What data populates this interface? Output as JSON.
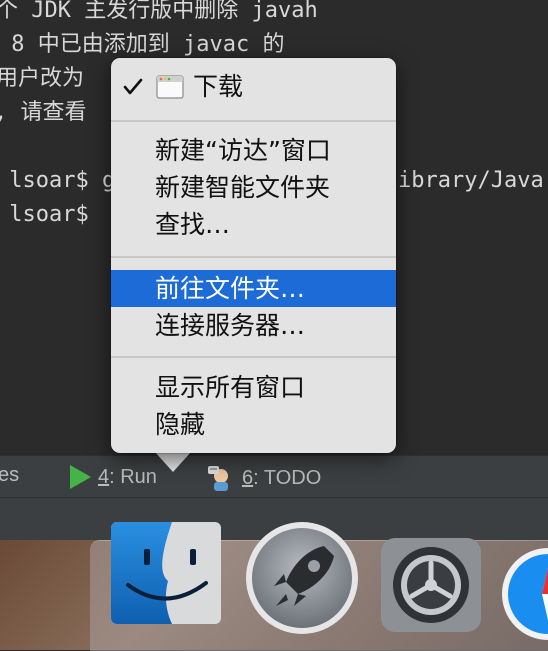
{
  "terminal": {
    "lines": [
      "个 JDK 主发行版中删除 javah",
      " 8 中已由添加到 javac 的",
      "用户改为",
      ", 请查看",
      "",
      " lsoar$ g",
      " lsoar$"
    ],
    "right_fragment": "ibrary/Java"
  },
  "ide_bar": {
    "prefix": "es",
    "run_number": "4",
    "run_label": ": Run",
    "todo_number": "6",
    "todo_label": ": TODO"
  },
  "menu": {
    "folder_item": "下载",
    "group1": [
      "新建“访达”窗口",
      "新建智能文件夹",
      "查找…"
    ],
    "group2": [
      "前往文件夹…",
      "连接服务器…"
    ],
    "group3": [
      "显示所有窗口",
      "隐藏"
    ]
  },
  "colors": {
    "highlight": "#1c6bd6",
    "menu_bg": "#e3e3e3",
    "terminal_bg": "#2b2b2b",
    "run_green": "#45b348"
  }
}
